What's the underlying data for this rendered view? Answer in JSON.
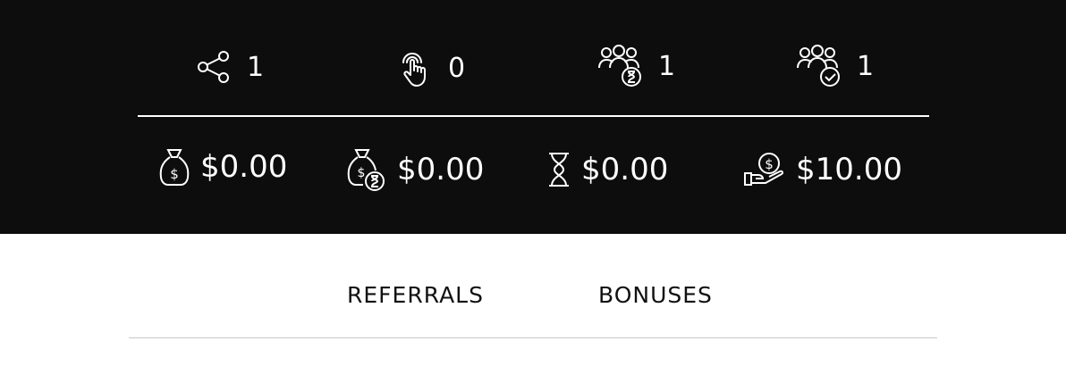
{
  "stats_row1": [
    {
      "icon": "share-icon",
      "value": "1"
    },
    {
      "icon": "tap-click-icon",
      "value": "0"
    },
    {
      "icon": "users-pending-icon",
      "value": "1"
    },
    {
      "icon": "users-approved-icon",
      "value": "1"
    }
  ],
  "stats_row2": [
    {
      "icon": "money-bag-icon",
      "value": "$0.00"
    },
    {
      "icon": "money-bag-pending-icon",
      "value": "$0.00"
    },
    {
      "icon": "hourglass-icon",
      "value": "$0.00"
    },
    {
      "icon": "hand-coin-icon",
      "value": "$10.00"
    }
  ],
  "tabs": [
    {
      "label": "REFERRALS"
    },
    {
      "label": "BONUSES"
    }
  ],
  "colors": {
    "panel_bg": "#0d0d0d",
    "text_light": "#ffffff",
    "text_dark": "#111111",
    "line": "#c9c9c9"
  }
}
